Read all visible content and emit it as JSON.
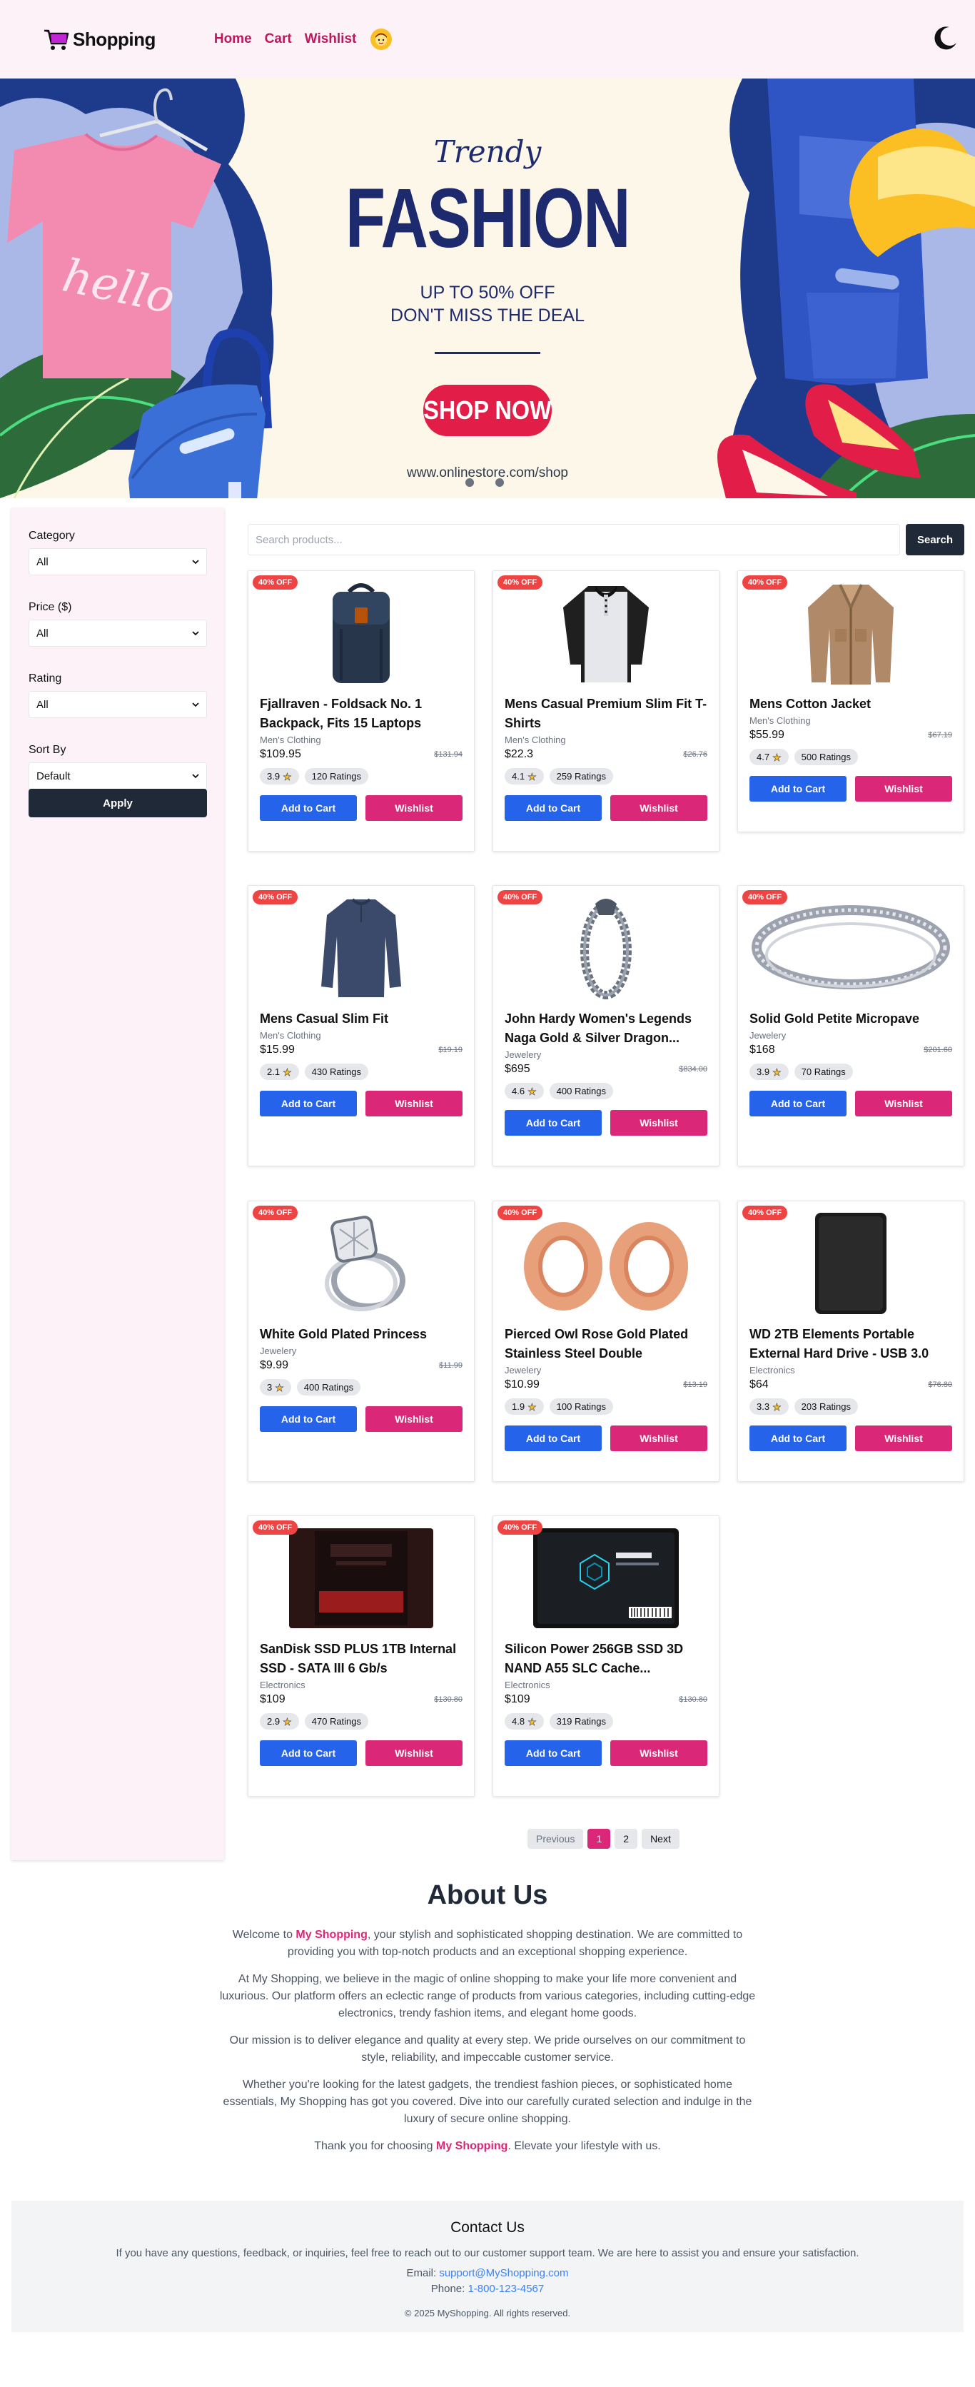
{
  "header": {
    "logo_text": "Shopping",
    "nav": [
      "Home",
      "Cart",
      "Wishlist"
    ]
  },
  "banner": {
    "trendy": "Trendy",
    "fashion": "FASHION",
    "offer": "UP TO 50% OFF",
    "subtitle": "DON'T MISS THE DEAL",
    "cta": "SHOP NOW",
    "url": "www.onlinestore.com/shop"
  },
  "filters": {
    "category_label": "Category",
    "category_value": "All",
    "price_label": "Price ($)",
    "price_value": "All",
    "rating_label": "Rating",
    "rating_value": "All",
    "sort_label": "Sort By",
    "sort_value": "Default",
    "apply": "Apply"
  },
  "search": {
    "placeholder": "Search products...",
    "button": "Search"
  },
  "labels": {
    "badge": "40% OFF",
    "ratings_suffix": "Ratings",
    "add_to_cart": "Add to Cart",
    "wishlist": "Wishlist"
  },
  "products": [
    {
      "title": "Fjallraven - Foldsack No. 1 Backpack, Fits 15 Laptops",
      "category": "Men's Clothing",
      "price": "$109.95",
      "original": "$131.94",
      "rating": "3.9",
      "ratings": "120 Ratings",
      "icon": "backpack-image"
    },
    {
      "title": "Mens Casual Premium Slim Fit T-Shirts",
      "category": "Men's Clothing",
      "price": "$22.3",
      "original": "$26.76",
      "rating": "4.1",
      "ratings": "259 Ratings",
      "icon": "tshirt-image"
    },
    {
      "title": "Mens Cotton Jacket",
      "category": "Men's Clothing",
      "price": "$55.99",
      "original": "$67.19",
      "rating": "4.7",
      "ratings": "500 Ratings",
      "icon": "jacket-image"
    },
    {
      "title": "Mens Casual Slim Fit",
      "category": "Men's Clothing",
      "price": "$15.99",
      "original": "$19.19",
      "rating": "2.1",
      "ratings": "430 Ratings",
      "icon": "longsleeve-image"
    },
    {
      "title": "John Hardy Women's Legends Naga Gold & Silver Dragon...",
      "category": "Jewelery",
      "price": "$695",
      "original": "$834.00",
      "rating": "4.6",
      "ratings": "400 Ratings",
      "icon": "bracelet-image"
    },
    {
      "title": "Solid Gold Petite Micropave",
      "category": "Jewelery",
      "price": "$168",
      "original": "$201.60",
      "rating": "3.9",
      "ratings": "70 Ratings",
      "icon": "ring-band-image"
    },
    {
      "title": "White Gold Plated Princess",
      "category": "Jewelery",
      "price": "$9.99",
      "original": "$11.99",
      "rating": "3",
      "ratings": "400 Ratings",
      "icon": "diamond-ring-image"
    },
    {
      "title": "Pierced Owl Rose Gold Plated Stainless Steel Double",
      "category": "Jewelery",
      "price": "$10.99",
      "original": "$13.19",
      "rating": "1.9",
      "ratings": "100 Ratings",
      "icon": "plugs-image"
    },
    {
      "title": "WD 2TB Elements Portable External Hard Drive - USB 3.0",
      "category": "Electronics",
      "price": "$64",
      "original": "$76.80",
      "rating": "3.3",
      "ratings": "203 Ratings",
      "icon": "hard-drive-image"
    },
    {
      "title": "SanDisk SSD PLUS 1TB Internal SSD - SATA III 6 Gb/s",
      "category": "Electronics",
      "price": "$109",
      "original": "$130.80",
      "rating": "2.9",
      "ratings": "470 Ratings",
      "icon": "sandisk-ssd-image"
    },
    {
      "title": "Silicon Power 256GB SSD 3D NAND A55 SLC Cache...",
      "category": "Electronics",
      "price": "$109",
      "original": "$130.80",
      "rating": "4.8",
      "ratings": "319 Ratings",
      "icon": "silicon-power-ssd-image"
    }
  ],
  "pagination": {
    "previous": "Previous",
    "pages": [
      "1",
      "2"
    ],
    "active": "1",
    "next": "Next"
  },
  "about": {
    "title": "About Us",
    "p1_before": "Welcome to ",
    "brand": "My Shopping",
    "p1_after": ", your stylish and sophisticated shopping destination. We are committed to providing you with top-notch products and an exceptional shopping experience.",
    "p2": "At My Shopping, we believe in the magic of online shopping to make your life more convenient and luxurious. Our platform offers an eclectic range of products from various categories, including cutting-edge electronics, trendy fashion items, and elegant home goods.",
    "p3": "Our mission is to deliver elegance and quality at every step. We pride ourselves on our commitment to style, reliability, and impeccable customer service.",
    "p4": "Whether you're looking for the latest gadgets, the trendiest fashion pieces, or sophisticated home essentials, My Shopping has got you covered. Dive into our carefully curated selection and indulge in the luxury of secure online shopping.",
    "p5_before": "Thank you for choosing ",
    "p5_after": ". Elevate your lifestyle with us."
  },
  "contact": {
    "title": "Contact Us",
    "text": "If you have any questions, feedback, or inquiries, feel free to reach out to our customer support team. We are here to assist you and ensure your satisfaction.",
    "email_label": "Email: ",
    "email": "support@MyShopping.com",
    "phone_label": "Phone: ",
    "phone": "1-800-123-4567",
    "copyright": "© 2025 MyShopping. All rights reserved."
  }
}
